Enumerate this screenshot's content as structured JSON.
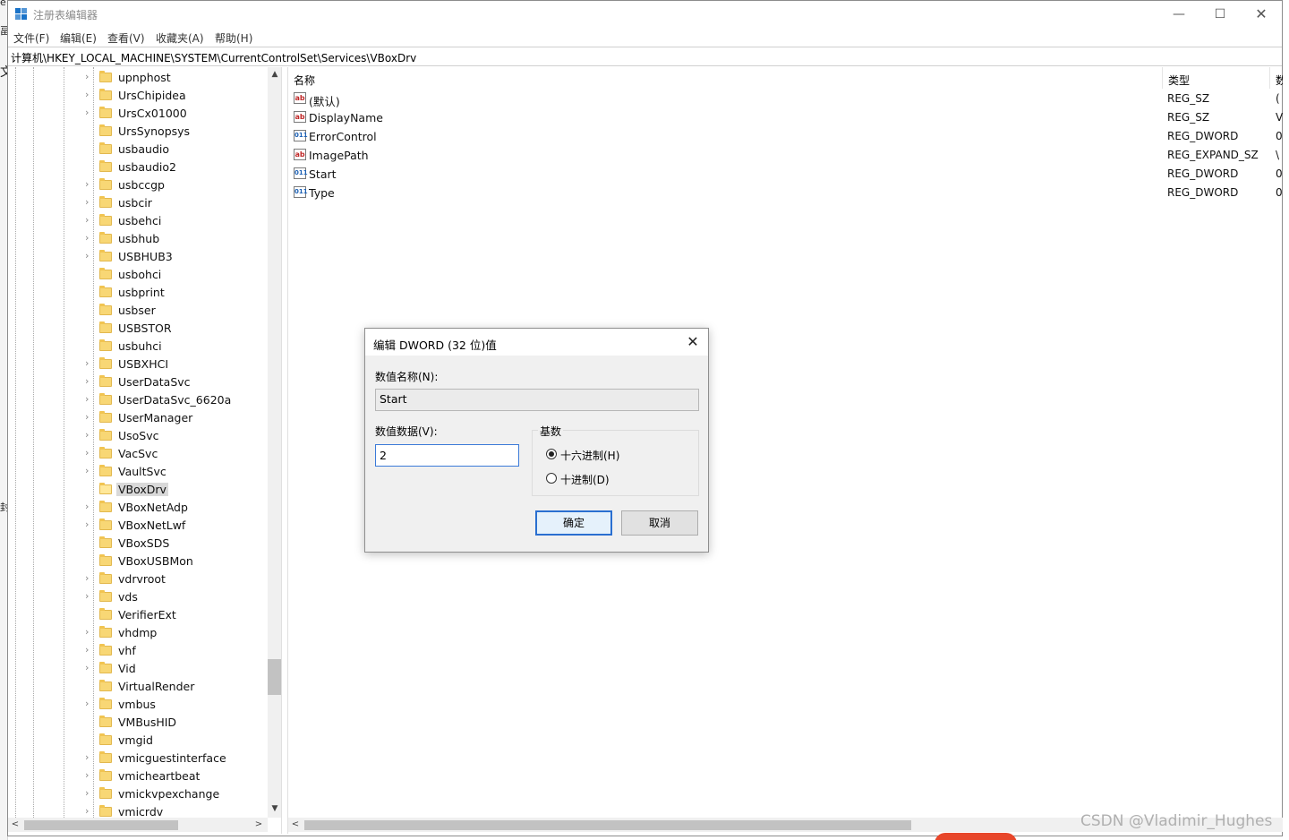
{
  "window": {
    "title": "注册表编辑器",
    "minimize_glyph": "—",
    "maximize_glyph": "☐",
    "close_glyph": "✕"
  },
  "background_fragments": [
    "e",
    "畐",
    "文",
    "封"
  ],
  "menu": [
    "文件(F)",
    "编辑(E)",
    "查看(V)",
    "收藏夹(A)",
    "帮助(H)"
  ],
  "address": "计算机\\HKEY_LOCAL_MACHINE\\SYSTEM\\CurrentControlSet\\Services\\VBoxDrv",
  "tree": {
    "items": [
      {
        "label": "upnphost",
        "expandable": true
      },
      {
        "label": "UrsChipidea",
        "expandable": true
      },
      {
        "label": "UrsCx01000",
        "expandable": true
      },
      {
        "label": "UrsSynopsys",
        "expandable": false
      },
      {
        "label": "usbaudio",
        "expandable": false
      },
      {
        "label": "usbaudio2",
        "expandable": false
      },
      {
        "label": "usbccgp",
        "expandable": true
      },
      {
        "label": "usbcir",
        "expandable": true
      },
      {
        "label": "usbehci",
        "expandable": true
      },
      {
        "label": "usbhub",
        "expandable": true
      },
      {
        "label": "USBHUB3",
        "expandable": true
      },
      {
        "label": "usbohci",
        "expandable": false
      },
      {
        "label": "usbprint",
        "expandable": false
      },
      {
        "label": "usbser",
        "expandable": false
      },
      {
        "label": "USBSTOR",
        "expandable": false
      },
      {
        "label": "usbuhci",
        "expandable": false
      },
      {
        "label": "USBXHCI",
        "expandable": true
      },
      {
        "label": "UserDataSvc",
        "expandable": true
      },
      {
        "label": "UserDataSvc_6620a",
        "expandable": true
      },
      {
        "label": "UserManager",
        "expandable": true
      },
      {
        "label": "UsoSvc",
        "expandable": true
      },
      {
        "label": "VacSvc",
        "expandable": true
      },
      {
        "label": "VaultSvc",
        "expandable": true
      },
      {
        "label": "VBoxDrv",
        "expandable": false,
        "selected": true
      },
      {
        "label": "VBoxNetAdp",
        "expandable": true
      },
      {
        "label": "VBoxNetLwf",
        "expandable": true
      },
      {
        "label": "VBoxSDS",
        "expandable": false
      },
      {
        "label": "VBoxUSBMon",
        "expandable": false
      },
      {
        "label": "vdrvroot",
        "expandable": true
      },
      {
        "label": "vds",
        "expandable": true
      },
      {
        "label": "VerifierExt",
        "expandable": false
      },
      {
        "label": "vhdmp",
        "expandable": true
      },
      {
        "label": "vhf",
        "expandable": true
      },
      {
        "label": "Vid",
        "expandable": true
      },
      {
        "label": "VirtualRender",
        "expandable": false
      },
      {
        "label": "vmbus",
        "expandable": true
      },
      {
        "label": "VMBusHID",
        "expandable": false
      },
      {
        "label": "vmgid",
        "expandable": false
      },
      {
        "label": "vmicguestinterface",
        "expandable": true
      },
      {
        "label": "vmicheartbeat",
        "expandable": true
      },
      {
        "label": "vmickvpexchange",
        "expandable": true
      },
      {
        "label": "vmicrdv",
        "expandable": true
      }
    ]
  },
  "values": {
    "columns": [
      "名称",
      "类型",
      "数"
    ],
    "rows": [
      {
        "icon": "string-value-icon",
        "name": "(默认)",
        "type": "REG_SZ",
        "data": "("
      },
      {
        "icon": "string-value-icon",
        "name": "DisplayName",
        "type": "REG_SZ",
        "data": "V"
      },
      {
        "icon": "binary-value-icon",
        "name": "ErrorControl",
        "type": "REG_DWORD",
        "data": "0"
      },
      {
        "icon": "string-value-icon",
        "name": "ImagePath",
        "type": "REG_EXPAND_SZ",
        "data": "\\"
      },
      {
        "icon": "binary-value-icon",
        "name": "Start",
        "type": "REG_DWORD",
        "data": "0"
      },
      {
        "icon": "binary-value-icon",
        "name": "Type",
        "type": "REG_DWORD",
        "data": "0"
      }
    ]
  },
  "dialog": {
    "title": "编辑 DWORD (32 位)值",
    "name_label": "数值名称(N):",
    "name_value": "Start",
    "data_label": "数值数据(V):",
    "data_value": "2",
    "base_label": "基数",
    "radio_hex": "十六进制(H)",
    "radio_dec": "十进制(D)",
    "selected_base": "hex",
    "ok": "确定",
    "cancel": "取消"
  },
  "watermark": "CSDN @Vladimir_Hughes"
}
